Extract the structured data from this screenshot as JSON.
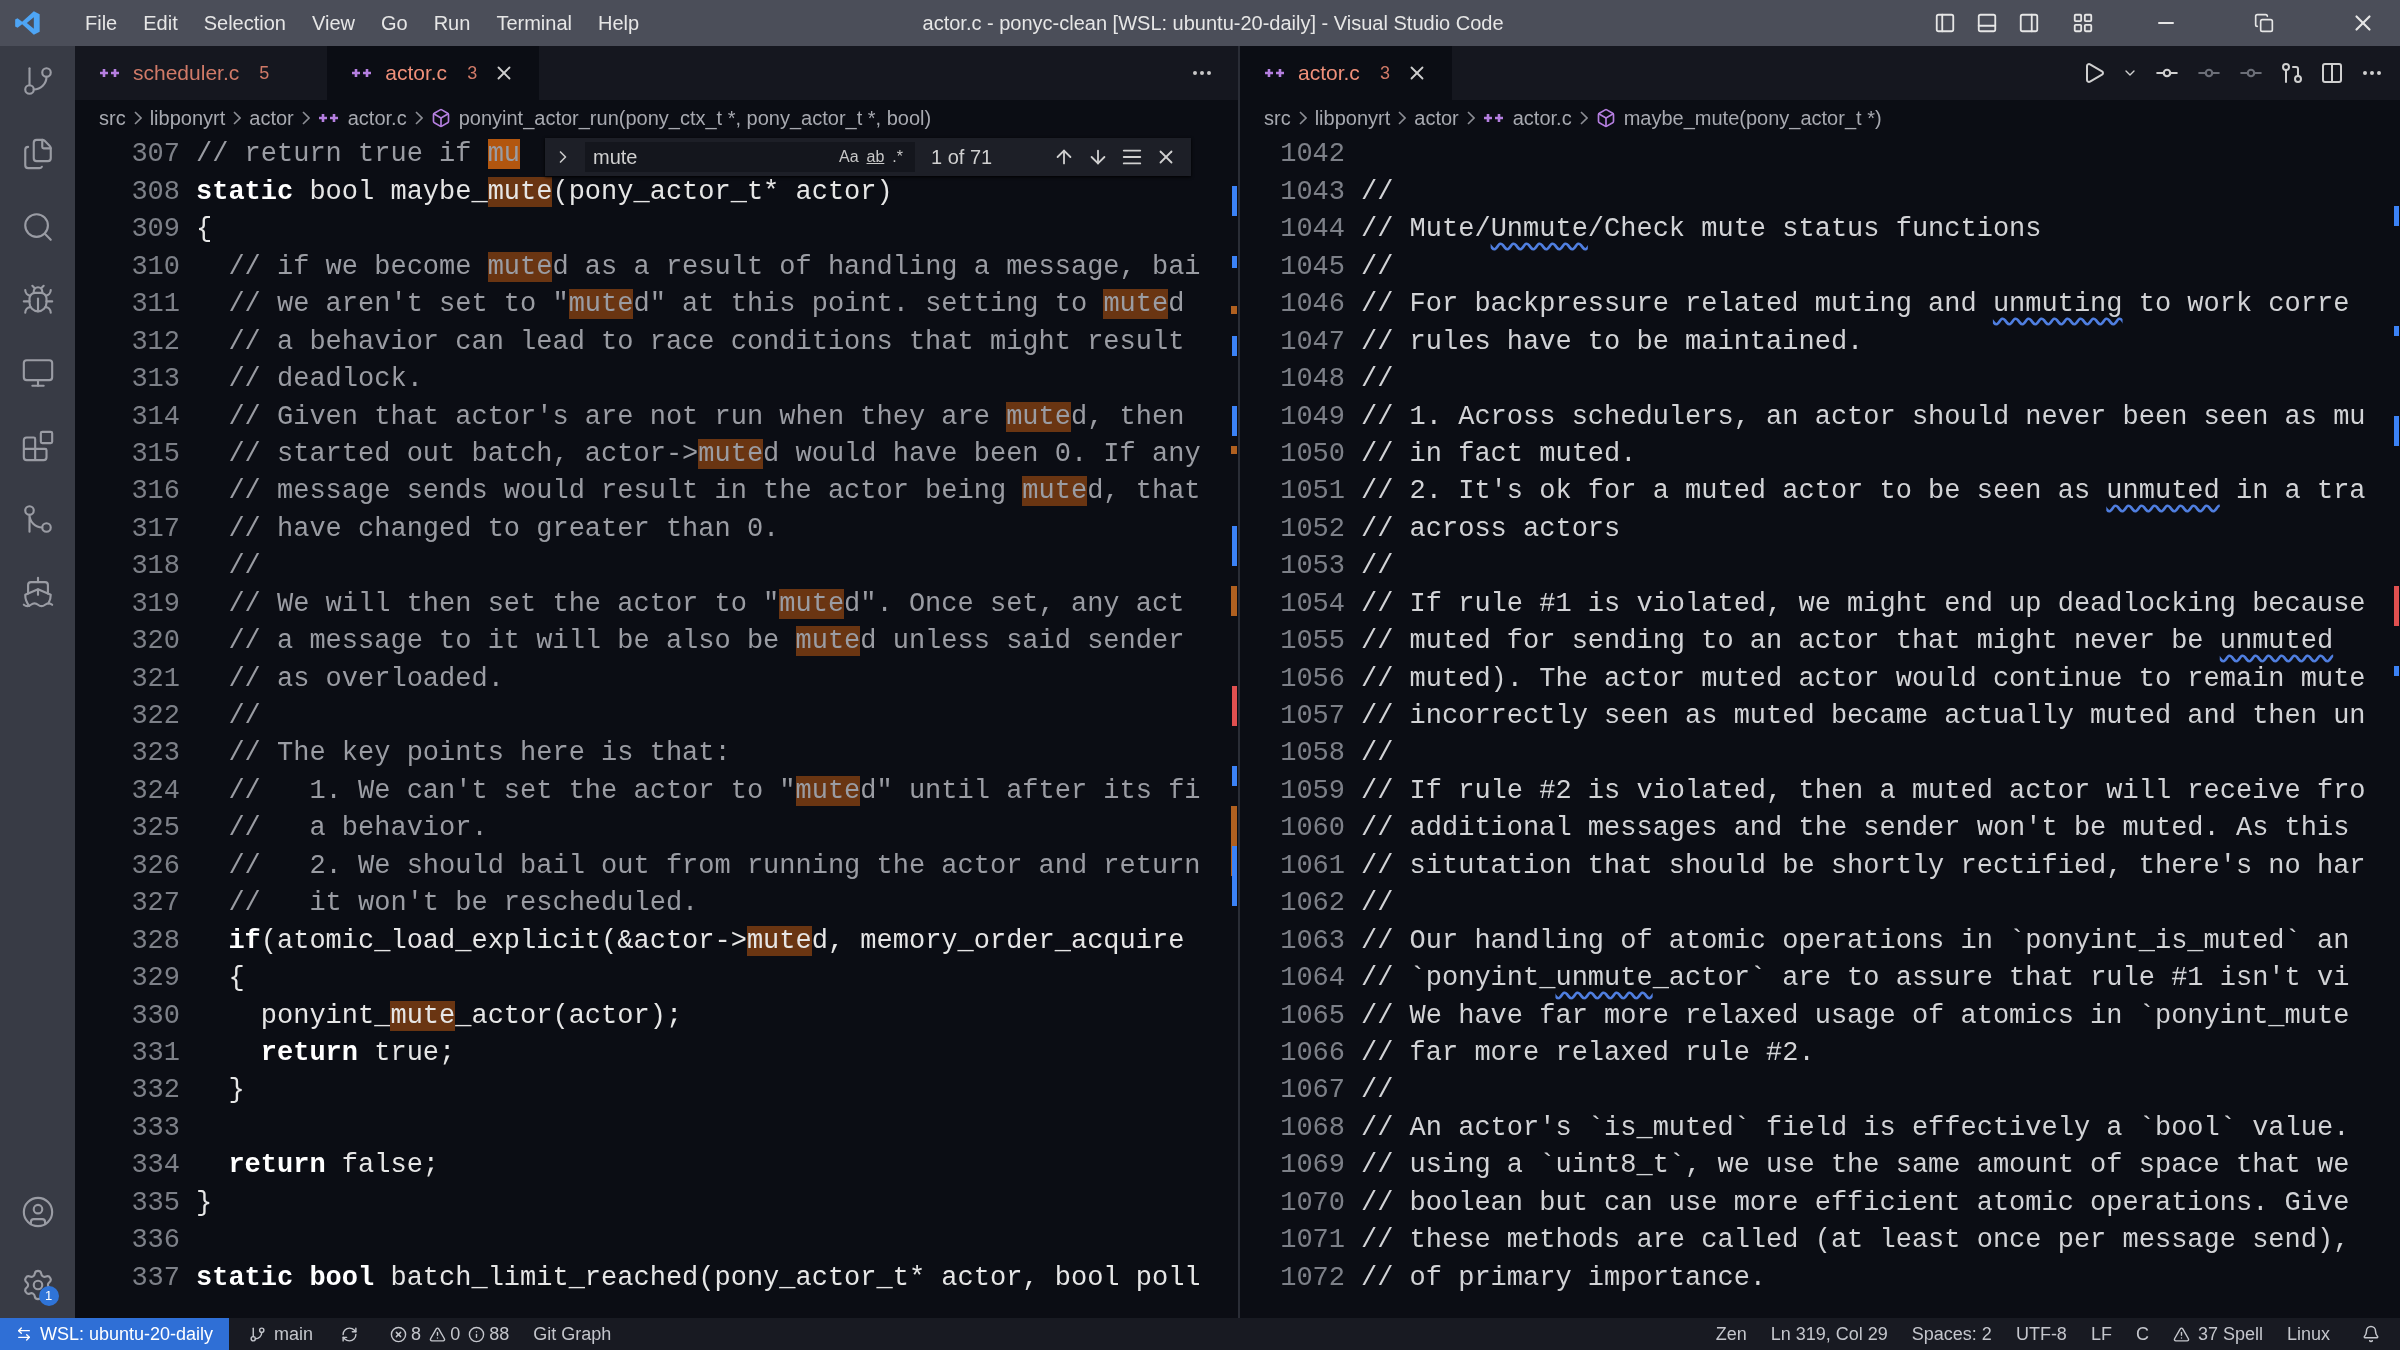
{
  "title_bar": {
    "menu": [
      "File",
      "Edit",
      "Selection",
      "View",
      "Go",
      "Run",
      "Terminal",
      "Help"
    ],
    "title": "actor.c - ponyc-clean [WSL: ubuntu-20-daily] - Visual Studio Code"
  },
  "activity_bar": {
    "settings_badge": "1"
  },
  "editor_groups": [
    {
      "focused": false,
      "tabs": [
        {
          "label": "scheduler.c",
          "problems": "5",
          "selected": false
        },
        {
          "label": "actor.c",
          "problems": "3",
          "selected": true
        }
      ],
      "breadcrumb": [
        {
          "text": "src",
          "kind": "folder"
        },
        {
          "text": "libponyrt",
          "kind": "folder"
        },
        {
          "text": "actor",
          "kind": "folder"
        },
        {
          "text": "actor.c",
          "kind": "file"
        },
        {
          "text": "ponyint_actor_run(pony_ctx_t *, pony_actor_t *, bool)",
          "kind": "symbol"
        }
      ],
      "find": {
        "query": "mute",
        "options": [
          "Aa",
          "ab",
          ".*"
        ],
        "count": "1 of 71"
      },
      "lines": [
        {
          "number": "307",
          "kind": "comment",
          "segments": [
            {
              "text": "// return true if ",
              "kind": "text"
            },
            {
              "text": "mu",
              "kind": "current_match"
            }
          ]
        },
        {
          "number": "308",
          "kind": "code",
          "segments": [
            {
              "text": "static",
              "kind": "keyword"
            },
            {
              "text": " bool maybe_",
              "kind": "text"
            },
            {
              "text": "mute",
              "kind": "match"
            },
            {
              "text": "(pony_actor_t* actor)",
              "kind": "text"
            }
          ]
        },
        {
          "number": "309",
          "kind": "code",
          "segments": [
            {
              "text": "{",
              "kind": "text"
            }
          ]
        },
        {
          "number": "310",
          "kind": "comment",
          "segments": [
            {
              "text": "  // if we become ",
              "kind": "text"
            },
            {
              "text": "mute",
              "kind": "match"
            },
            {
              "text": "d as a result of handling a message, bai",
              "kind": "text"
            }
          ]
        },
        {
          "number": "311",
          "kind": "comment",
          "segments": [
            {
              "text": "  // we aren't set to \"",
              "kind": "text"
            },
            {
              "text": "mute",
              "kind": "match"
            },
            {
              "text": "d\" at this point. setting to ",
              "kind": "text"
            },
            {
              "text": "mute",
              "kind": "match"
            },
            {
              "text": "d",
              "kind": "text"
            }
          ]
        },
        {
          "number": "312",
          "kind": "comment",
          "segments": [
            {
              "text": "  // a behavior can lead to race conditions that might result",
              "kind": "text"
            }
          ]
        },
        {
          "number": "313",
          "kind": "comment",
          "segments": [
            {
              "text": "  // deadlock.",
              "kind": "text"
            }
          ]
        },
        {
          "number": "314",
          "kind": "comment",
          "segments": [
            {
              "text": "  // Given that actor's are not run when they are ",
              "kind": "text"
            },
            {
              "text": "mute",
              "kind": "match"
            },
            {
              "text": "d, then",
              "kind": "text"
            }
          ]
        },
        {
          "number": "315",
          "kind": "comment",
          "segments": [
            {
              "text": "  // started out batch, actor->",
              "kind": "text"
            },
            {
              "text": "mute",
              "kind": "match"
            },
            {
              "text": "d would have been 0. If any",
              "kind": "text"
            }
          ]
        },
        {
          "number": "316",
          "kind": "comment",
          "segments": [
            {
              "text": "  // message sends would result in the actor being ",
              "kind": "text"
            },
            {
              "text": "mute",
              "kind": "match"
            },
            {
              "text": "d, that",
              "kind": "text"
            }
          ]
        },
        {
          "number": "317",
          "kind": "comment",
          "segments": [
            {
              "text": "  // have changed to greater than 0.",
              "kind": "text"
            }
          ]
        },
        {
          "number": "318",
          "kind": "comment",
          "segments": [
            {
              "text": "  //",
              "kind": "text"
            }
          ]
        },
        {
          "number": "319",
          "kind": "comment",
          "segments": [
            {
              "text": "  // We will then set the actor to \"",
              "kind": "text"
            },
            {
              "text": "mute",
              "kind": "match"
            },
            {
              "text": "d\". Once set, any act",
              "kind": "text"
            }
          ]
        },
        {
          "number": "320",
          "kind": "comment",
          "segments": [
            {
              "text": "  // a message to it will be also be ",
              "kind": "text"
            },
            {
              "text": "mute",
              "kind": "match"
            },
            {
              "text": "d unless said sender",
              "kind": "text"
            }
          ]
        },
        {
          "number": "321",
          "kind": "comment",
          "segments": [
            {
              "text": "  // as overloaded.",
              "kind": "text"
            }
          ]
        },
        {
          "number": "322",
          "kind": "comment",
          "segments": [
            {
              "text": "  //",
              "kind": "text"
            }
          ]
        },
        {
          "number": "323",
          "kind": "comment",
          "segments": [
            {
              "text": "  // The key points here is that:",
              "kind": "text"
            }
          ]
        },
        {
          "number": "324",
          "kind": "comment",
          "segments": [
            {
              "text": "  //   1. We can't set the actor to \"",
              "kind": "text"
            },
            {
              "text": "mute",
              "kind": "match"
            },
            {
              "text": "d\" until after its fi",
              "kind": "text"
            }
          ]
        },
        {
          "number": "325",
          "kind": "comment",
          "segments": [
            {
              "text": "  //   a behavior.",
              "kind": "text"
            }
          ]
        },
        {
          "number": "326",
          "kind": "comment",
          "segments": [
            {
              "text": "  //   2. We should bail out from running the actor and return",
              "kind": "text"
            }
          ]
        },
        {
          "number": "327",
          "kind": "comment",
          "segments": [
            {
              "text": "  //   it won't be rescheduled.",
              "kind": "text"
            }
          ]
        },
        {
          "number": "328",
          "kind": "code",
          "segments": [
            {
              "text": "  if",
              "kind": "keyword"
            },
            {
              "text": "(atomic_load_explicit(&actor->",
              "kind": "text"
            },
            {
              "text": "mute",
              "kind": "match"
            },
            {
              "text": "d, memory_order_acquire",
              "kind": "text"
            }
          ]
        },
        {
          "number": "329",
          "kind": "code",
          "segments": [
            {
              "text": "  {",
              "kind": "text"
            }
          ]
        },
        {
          "number": "330",
          "kind": "code",
          "segments": [
            {
              "text": "    ponyint_",
              "kind": "text"
            },
            {
              "text": "mute",
              "kind": "match"
            },
            {
              "text": "_actor(actor);",
              "kind": "text"
            }
          ]
        },
        {
          "number": "331",
          "kind": "code",
          "segments": [
            {
              "text": "    return",
              "kind": "keyword"
            },
            {
              "text": " true;",
              "kind": "text"
            }
          ]
        },
        {
          "number": "332",
          "kind": "code",
          "segments": [
            {
              "text": "  }",
              "kind": "text"
            }
          ]
        },
        {
          "number": "333",
          "kind": "code"
        },
        {
          "number": "334",
          "kind": "code",
          "segments": [
            {
              "text": "  return",
              "kind": "keyword"
            },
            {
              "text": " false;",
              "kind": "text"
            }
          ]
        },
        {
          "number": "335",
          "kind": "code",
          "segments": [
            {
              "text": "}",
              "kind": "text"
            }
          ]
        },
        {
          "number": "336",
          "kind": "code"
        },
        {
          "number": "337",
          "kind": "code",
          "segments": [
            {
              "text": "static bool",
              "kind": "keyword"
            },
            {
              "text": " batch_limit_reached(pony_actor_t* actor, bool poll",
              "kind": "text"
            }
          ]
        }
      ]
    },
    {
      "focused": true,
      "tabs": [
        {
          "label": "actor.c",
          "problems": "3",
          "selected": true
        }
      ],
      "breadcrumb": [
        {
          "text": "src",
          "kind": "folder"
        },
        {
          "text": "libponyrt",
          "kind": "folder"
        },
        {
          "text": "actor",
          "kind": "folder"
        },
        {
          "text": "actor.c",
          "kind": "file"
        },
        {
          "text": "maybe_mute(pony_actor_t *)",
          "kind": "symbol"
        }
      ],
      "lines": [
        {
          "number": "1042",
          "kind": "comment"
        },
        {
          "number": "1043",
          "kind": "comment",
          "segments": [
            {
              "text": "//",
              "kind": "text"
            }
          ]
        },
        {
          "number": "1044",
          "kind": "comment",
          "segments": [
            {
              "text": "// Mute/",
              "kind": "text"
            },
            {
              "text": "Unmute",
              "kind": "spell"
            },
            {
              "text": "/Check mute status functions",
              "kind": "text"
            }
          ]
        },
        {
          "number": "1045",
          "kind": "comment",
          "segments": [
            {
              "text": "//",
              "kind": "text"
            }
          ]
        },
        {
          "number": "1046",
          "kind": "comment",
          "segments": [
            {
              "text": "// For backpressure related muting and ",
              "kind": "text"
            },
            {
              "text": "unmuting",
              "kind": "spell"
            },
            {
              "text": " to work corre",
              "kind": "text"
            }
          ]
        },
        {
          "number": "1047",
          "kind": "comment",
          "segments": [
            {
              "text": "// rules have to be maintained.",
              "kind": "text"
            }
          ]
        },
        {
          "number": "1048",
          "kind": "comment",
          "segments": [
            {
              "text": "//",
              "kind": "text"
            }
          ]
        },
        {
          "number": "1049",
          "kind": "comment",
          "segments": [
            {
              "text": "// 1. Across schedulers, an actor should never been seen as mu",
              "kind": "text"
            }
          ]
        },
        {
          "number": "1050",
          "kind": "comment",
          "segments": [
            {
              "text": "// in fact muted.",
              "kind": "text"
            }
          ]
        },
        {
          "number": "1051",
          "kind": "comment",
          "segments": [
            {
              "text": "// 2. It's ok for a muted actor to be seen as ",
              "kind": "text"
            },
            {
              "text": "unmuted",
              "kind": "spell"
            },
            {
              "text": " in a tra",
              "kind": "text"
            }
          ]
        },
        {
          "number": "1052",
          "kind": "comment",
          "segments": [
            {
              "text": "// across actors",
              "kind": "text"
            }
          ]
        },
        {
          "number": "1053",
          "kind": "comment",
          "segments": [
            {
              "text": "//",
              "kind": "text"
            }
          ]
        },
        {
          "number": "1054",
          "kind": "comment",
          "segments": [
            {
              "text": "// If rule #1 is violated, we might end up deadlocking because",
              "kind": "text"
            }
          ]
        },
        {
          "number": "1055",
          "kind": "comment",
          "segments": [
            {
              "text": "// muted for sending to an actor that might never be ",
              "kind": "text"
            },
            {
              "text": "unmuted",
              "kind": "spell"
            }
          ]
        },
        {
          "number": "1056",
          "kind": "comment",
          "segments": [
            {
              "text": "// muted). The actor muted actor would continue to remain mute",
              "kind": "text"
            }
          ]
        },
        {
          "number": "1057",
          "kind": "comment",
          "segments": [
            {
              "text": "// incorrectly seen as muted became actually muted and then un",
              "kind": "text"
            }
          ]
        },
        {
          "number": "1058",
          "kind": "comment",
          "segments": [
            {
              "text": "//",
              "kind": "text"
            }
          ]
        },
        {
          "number": "1059",
          "kind": "comment",
          "segments": [
            {
              "text": "// If rule #2 is violated, then a muted actor will receive fro",
              "kind": "text"
            }
          ]
        },
        {
          "number": "1060",
          "kind": "comment",
          "segments": [
            {
              "text": "// additional messages and the sender won't be muted. As this",
              "kind": "text"
            }
          ]
        },
        {
          "number": "1061",
          "kind": "comment",
          "segments": [
            {
              "text": "// situtation that should be shortly rectified, there's no har",
              "kind": "text"
            }
          ]
        },
        {
          "number": "1062",
          "kind": "comment",
          "segments": [
            {
              "text": "//",
              "kind": "text"
            }
          ]
        },
        {
          "number": "1063",
          "kind": "comment",
          "segments": [
            {
              "text": "// Our handling of atomic operations in `ponyint_is_muted` an",
              "kind": "text"
            }
          ]
        },
        {
          "number": "1064",
          "kind": "comment",
          "segments": [
            {
              "text": "// `ponyint_",
              "kind": "text"
            },
            {
              "text": "unmute",
              "kind": "spell"
            },
            {
              "text": "_actor` are to assure that rule #1 isn't vi",
              "kind": "text"
            }
          ]
        },
        {
          "number": "1065",
          "kind": "comment",
          "segments": [
            {
              "text": "// We have far more relaxed usage of atomics in `ponyint_mute",
              "kind": "text"
            }
          ]
        },
        {
          "number": "1066",
          "kind": "comment",
          "segments": [
            {
              "text": "// far more relaxed rule #2.",
              "kind": "text"
            }
          ]
        },
        {
          "number": "1067",
          "kind": "comment",
          "segments": [
            {
              "text": "//",
              "kind": "text"
            }
          ]
        },
        {
          "number": "1068",
          "kind": "comment",
          "segments": [
            {
              "text": "// An actor's `is_muted` field is effectively a `bool` value.",
              "kind": "text"
            }
          ]
        },
        {
          "number": "1069",
          "kind": "comment",
          "segments": [
            {
              "text": "// using a `uint8_t`, we use the same amount of space that we",
              "kind": "text"
            }
          ]
        },
        {
          "number": "1070",
          "kind": "comment",
          "segments": [
            {
              "text": "// boolean but can use more efficient atomic operations. Give",
              "kind": "text"
            }
          ]
        },
        {
          "number": "1071",
          "kind": "comment",
          "segments": [
            {
              "text": "// these methods are called (at least once per message send),",
              "kind": "text"
            }
          ]
        },
        {
          "number": "1072",
          "kind": "comment",
          "segments": [
            {
              "text": "// of primary importance.",
              "kind": "text"
            }
          ]
        }
      ]
    }
  ],
  "status_bar": {
    "remote": "WSL: ubuntu-20-daily",
    "branch": "main",
    "errors": "8",
    "warnings": "0",
    "infos": "88",
    "git_graph": "Git Graph",
    "right": [
      {
        "text": "Zen",
        "kind": "text"
      },
      {
        "text": "Ln 319, Col 29",
        "kind": "text"
      },
      {
        "text": "Spaces: 2",
        "kind": "text"
      },
      {
        "text": "UTF-8",
        "kind": "text"
      },
      {
        "text": "LF",
        "kind": "text"
      },
      {
        "text": "C",
        "kind": "text"
      },
      {
        "text": "37 Spell",
        "kind": "warning"
      },
      {
        "text": "Linux",
        "kind": "text"
      }
    ]
  }
}
